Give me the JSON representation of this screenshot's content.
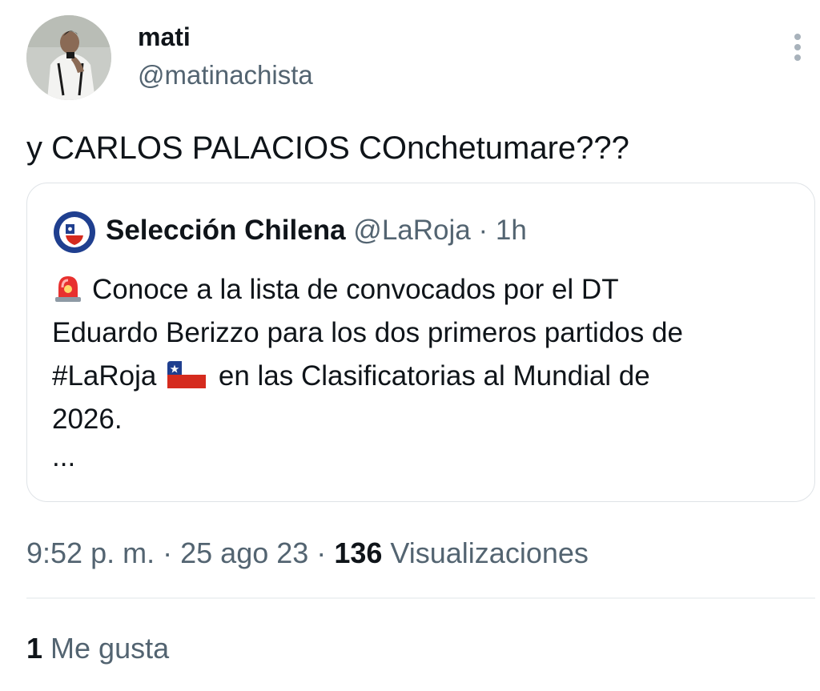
{
  "author": {
    "name": "mati",
    "handle": "@matinachista"
  },
  "tweet": {
    "text": "y CARLOS PALACIOS COnchetumare???"
  },
  "quoted_tweet": {
    "name": "Selección Chilena",
    "handle": "@LaRoja",
    "separator": "·",
    "time": "1h",
    "body_line1": "Conoce a la lista de convocados por el DT",
    "body_line2": "Eduardo Berizzo para los dos primeros partidos de",
    "body_line3_a": "#LaRoja",
    "body_line3_b": "en las Clasificatorias al Mundial de",
    "body_line4": "2026.",
    "ellipsis": "...",
    "emojis": [
      "police-siren-icon",
      "chile-flag-icon"
    ]
  },
  "meta": {
    "time": "9:52 p. m.",
    "sep1": "·",
    "date": "25 ago 23",
    "sep2": "·",
    "views_count": "136",
    "views_label": "Visualizaciones"
  },
  "likes": {
    "count": "1",
    "label": "Me gusta"
  },
  "colors": {
    "text_primary": "#0f1419",
    "text_secondary": "#536471",
    "border": "#dfe3e7",
    "divider": "#eff3f4"
  }
}
